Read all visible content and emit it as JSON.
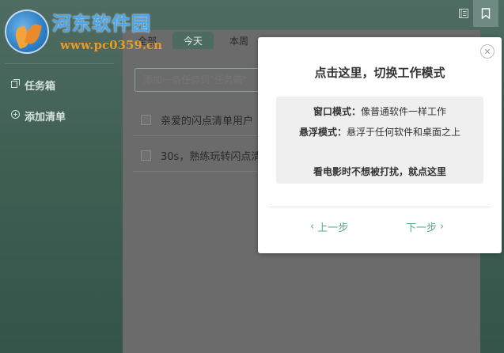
{
  "watermark": {
    "title": "河东软件园",
    "url": "www.pc0359.cn"
  },
  "toolbar": {
    "list_icon": "list-icon",
    "pin_icon": "bookmark-icon"
  },
  "sidebar": {
    "items": [
      {
        "label": "任务箱",
        "icon": "tasks-icon"
      },
      {
        "label": "添加清单",
        "icon": "add-circle-icon"
      }
    ]
  },
  "tabs": [
    {
      "label": "全部",
      "active": false
    },
    {
      "label": "今天",
      "active": true
    },
    {
      "label": "本周",
      "active": false
    }
  ],
  "add_task": {
    "placeholder": "添加一条任务到\"任务箱\""
  },
  "tasks": [
    {
      "text": "亲爱的闪点清单用户",
      "checked": false
    },
    {
      "text": "30s，熟练玩转闪点清单",
      "checked": false
    }
  ],
  "popup": {
    "title": "点击这里，切换工作模式",
    "window_mode_label": "窗口模式：",
    "window_mode_desc": "像普通软件一样工作",
    "float_mode_label": "悬浮模式：",
    "float_mode_desc": "悬浮于任何软件和桌面之上",
    "tip": "看电影时不想被打扰，就点这里",
    "prev_label": "上一步",
    "next_label": "下一步"
  },
  "colors": {
    "sidebar_bg": "#4e6c62",
    "accent": "#5aa88e",
    "active_tab": "#4d6b60",
    "watermark_blue": "#4aa5f0",
    "watermark_orange": "#e69b2c"
  }
}
